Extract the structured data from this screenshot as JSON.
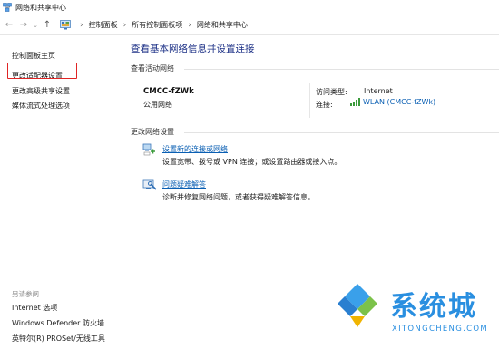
{
  "window": {
    "title": "网络和共享中心"
  },
  "addressbar": {
    "breadcrumbs": [
      "控制面板",
      "所有控制面板项",
      "网络和共享中心"
    ]
  },
  "left_pane": {
    "links": [
      "控制面板主页",
      "更改适配器设置",
      "更改高级共享设置",
      "媒体流式处理选项"
    ],
    "see_also_label": "另请参阅",
    "see_also_links": [
      "Internet 选项",
      "Windows Defender 防火墙",
      "英特尔(R) PROSet/无线工具"
    ]
  },
  "main": {
    "title": "查看基本网络信息并设置连接",
    "active_networks_label": "查看活动网络",
    "network": {
      "name": "CMCC-fZWk",
      "type": "公用网络",
      "access_type_label": "访问类型:",
      "access_type_value": "Internet",
      "connection_label": "连接:",
      "connection_value": "WLAN (CMCC-fZWk)"
    },
    "change_settings_label": "更改网络设置",
    "tasks": [
      {
        "link": "设置新的连接或网络",
        "desc": "设置宽带、拨号或 VPN 连接；或设置路由器或接入点。"
      },
      {
        "link": "问题疑难解答",
        "desc": "诊断并修复网络问题，或者获得疑难解答信息。"
      }
    ]
  },
  "watermark": {
    "name": "系统城",
    "url": "XITONGCHENG.COM"
  },
  "colors": {
    "accent_link": "#0a5fb3",
    "title_blue": "#1e3287",
    "highlight_red": "#e02424",
    "watermark_blue": "#2a8fe0"
  }
}
